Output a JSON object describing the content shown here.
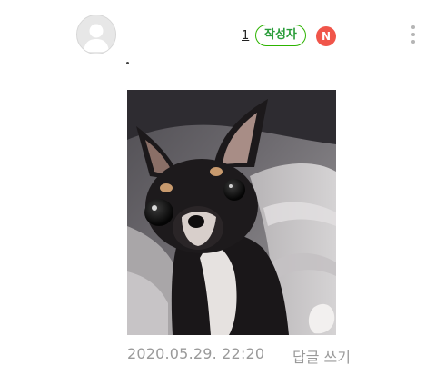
{
  "comment": {
    "nickname": "1",
    "author_badge": "작성자",
    "new_badge": "N",
    "timestamp": "2020.05.29. 22:20",
    "reply_label": "답글 쓰기"
  },
  "icons": {
    "avatar": "default-profile-icon",
    "more": "vertical-dots-icon"
  },
  "colors": {
    "author_badge_border": "#2db400",
    "new_badge_bg": "#f0554a",
    "meta_text": "#9a9a9a"
  }
}
